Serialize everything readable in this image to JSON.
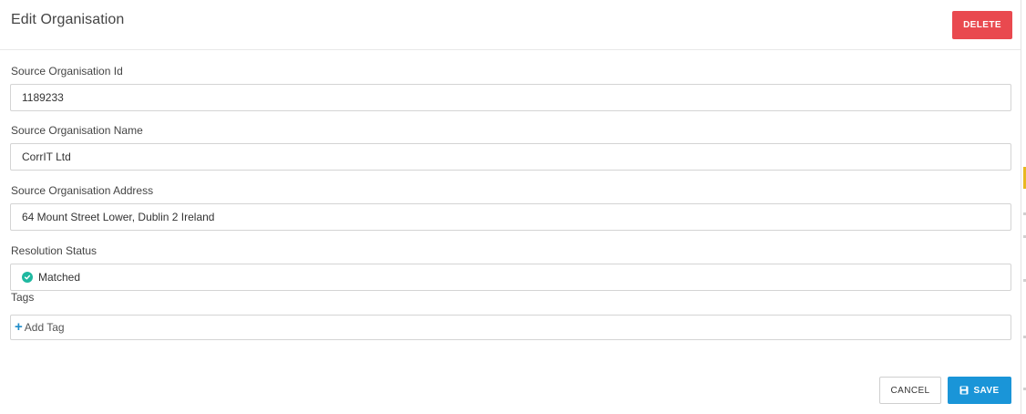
{
  "dialog": {
    "title": "Edit Organisation",
    "delete_label": "DELETE"
  },
  "form": {
    "source_id": {
      "label": "Source Organisation Id",
      "value": "1189233"
    },
    "source_name": {
      "label": "Source Organisation Name",
      "value": "CorrIT Ltd"
    },
    "source_address": {
      "label": "Source Organisation Address",
      "value": "64 Mount Street Lower, Dublin 2 Ireland"
    },
    "resolution_status": {
      "label": "Resolution Status",
      "value": "Matched",
      "icon": "check-circle-icon"
    },
    "tags": {
      "label": "Tags",
      "add_label": "Add Tag"
    }
  },
  "footer": {
    "cancel_label": "CANCEL",
    "save_label": "SAVE"
  },
  "colors": {
    "delete": "#e9494f",
    "save": "#1a95d8",
    "matched": "#1fb8a0",
    "add": "#1f8cc9"
  }
}
